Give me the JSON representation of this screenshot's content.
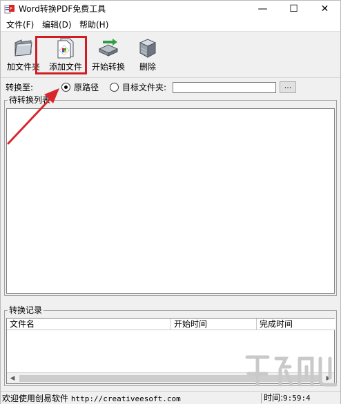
{
  "window": {
    "title": "Word转换PDF免费工具",
    "controls": {
      "minimize": "—",
      "maximize": "☐",
      "close": "✕"
    }
  },
  "menu": {
    "items": [
      "文件(F)",
      "编辑(D)",
      "帮助(H)"
    ]
  },
  "toolbar": {
    "buttons": [
      {
        "label": "加文件夹",
        "icon": "folder-icon"
      },
      {
        "label": "添加文件",
        "icon": "add-file-icon"
      },
      {
        "label": "开始转换",
        "icon": "convert-icon"
      },
      {
        "label": "删除",
        "icon": "delete-icon"
      }
    ],
    "highlight_color": "#d01c22"
  },
  "convert": {
    "label": "转换至:",
    "option_original": "原路径",
    "option_target": "目标文件夹:",
    "selected": "原路径",
    "path_value": "",
    "browse_label": "..."
  },
  "pending": {
    "legend": "待转换列表"
  },
  "records": {
    "legend": "转换记录",
    "columns": [
      "文件名",
      "开始时间",
      "完成时间"
    ]
  },
  "status": {
    "message": "欢迎使用创易软件",
    "url": "http://creativeesoft.com",
    "time_label": "时间:",
    "time_value": "9:59:4"
  },
  "annotation": {
    "arrow_color": "#d8262c"
  }
}
